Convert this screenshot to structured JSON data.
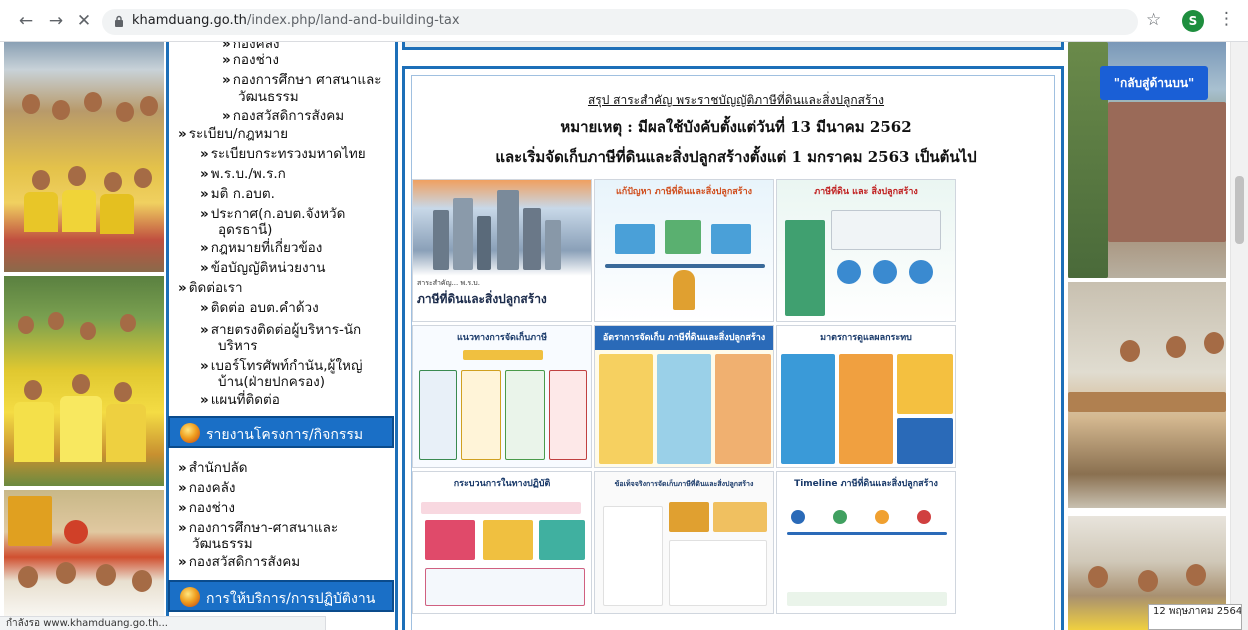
{
  "browser": {
    "url_host": "khamduang.go.th",
    "url_path": "/index.php/land-and-building-tax",
    "profile_initial": "S",
    "status_url": "กำลังรอ www.khamduang.go.th..."
  },
  "sidebar": {
    "top_items": [
      "กองคลัง",
      "กองช่าง",
      "กองการศึกษา ศาสนาและ",
      "วัฒนธรรม",
      "กองสวัสดิการสังคม"
    ],
    "regulations": {
      "label": "ระเบียบ/กฎหมาย",
      "items": [
        "ระเบียบกระทรวงมหาดไทย",
        "พ.ร.บ./พ.ร.ก",
        "มติ ก.อบต.",
        "ประกาศ(ก.อบต.จังหวัด",
        "อุดรธานี)",
        "กฎหมายที่เกี่ยวข้อง",
        "ข้อบัญญัติหน่วยงาน"
      ]
    },
    "contact": {
      "label": "ติดต่อเรา",
      "items": [
        "ติดต่อ อบต.คำด้วง",
        "สายตรงติดต่อผู้บริหาร-นัก",
        "บริหาร",
        "เบอร์โทรศัพท์กำนัน,ผู้ใหญ่",
        "บ้าน(ฝ่ายปกครอง)",
        "แผนที่ติดต่อ"
      ]
    },
    "reports_title": "รายงานโครงการ/กิจกรรม",
    "reports_items": [
      "สำนักปลัด",
      "กองคลัง",
      "กองช่าง",
      "กองการศึกษา-ศาสนาและ",
      "วัฒนธรรม",
      "กองสวัสดิการสังคม"
    ],
    "services_title": "การให้บริการ/การปฏิบัติงาน"
  },
  "content": {
    "heading_summary": "สรุป สาระสำคัญ พระราชบัญญัติภาษีที่ดินและสิ่งปลูกสร้าง",
    "heading_note": "หมายเหตุ : มีผลใช้บังคับตั้งแต่วันที่ 13 มีนาคม 2562",
    "heading_collect": "และเริ่มจัดเก็บภาษีที่ดินและสิ่งปลูกสร้างตั้งแต่ 1 มกราคม 2563 เป็นต้นไป",
    "tiles": [
      {
        "title": "ภาษีที่ดินและสิ่งปลูกสร้าง",
        "sub": "สาระสำคัญ... พ.ร.บ."
      },
      {
        "title": "แก้ปัญหา ภาษีที่ดินและสิ่งปลูกสร้าง",
        "sub": ""
      },
      {
        "title": "ภาษีที่ดิน และ สิ่งปลูกสร้าง",
        "sub": ""
      },
      {
        "title": "แนวทางการจัดเก็บภาษี",
        "sub": ""
      },
      {
        "title": "อัตราการจัดเก็บ ภาษีที่ดินและสิ่งปลูกสร้าง",
        "sub": ""
      },
      {
        "title": "มาตรการดูแลผลกระทบ",
        "sub": ""
      },
      {
        "title": "กระบวนการในทางปฏิบัติ",
        "sub": ""
      },
      {
        "title": "ข้อเท็จจริงการจัดเก็บภาษีที่ดินและสิ่งปลูกสร้าง",
        "sub": ""
      },
      {
        "title": "Timeline ภาษีที่ดินและสิ่งปลูกสร้าง",
        "sub": ""
      }
    ]
  },
  "right": {
    "back_to_top": "\"กลับสู่ด้านบน\"",
    "date_tip": "12 พฤษภาคม 2564"
  },
  "colors": {
    "frame_blue": "#1d6fb8",
    "section_blue": "#1a6fc6",
    "back_button_blue": "#1a5fd6"
  }
}
